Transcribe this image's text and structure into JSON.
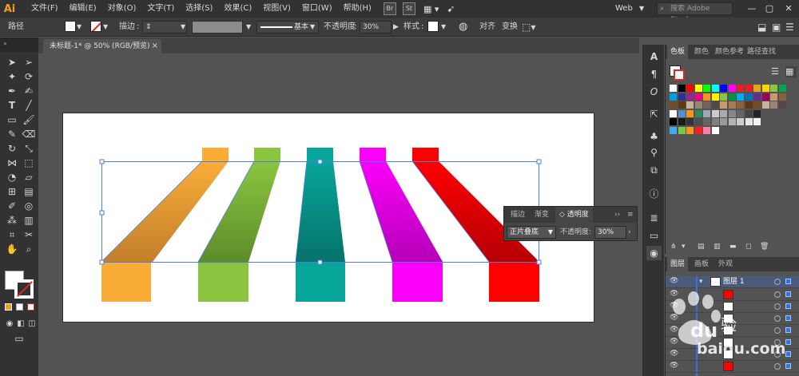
{
  "app": {
    "logo": "Ai"
  },
  "menu": [
    "文件(F)",
    "编辑(E)",
    "对象(O)",
    "文字(T)",
    "选择(S)",
    "效果(C)",
    "视图(V)",
    "窗口(W)",
    "帮助(H)"
  ],
  "menubar_right": {
    "br": "Br",
    "st": "St",
    "workspace": "Web",
    "search_placeholder": "搜索 Adobe Stock"
  },
  "controlbar": {
    "selection_type": "路径",
    "stroke_label": "描边",
    "stroke_style_label": "基本",
    "opacity_label": "不透明度",
    "opacity_value": "30%",
    "style_label": "样式",
    "align_label": "对齐",
    "transform_label": "变换"
  },
  "document": {
    "tab_title": "未标题-1* @ 50% (RGB/预览)"
  },
  "transparency_panel": {
    "tabs": [
      "描边",
      "渐变",
      "透明度"
    ],
    "blend_mode": "正片叠底",
    "opacity_label": "不透明度:",
    "opacity_value": "30%"
  },
  "swatches_panel": {
    "tabs": [
      "色板",
      "颜色",
      "颜色参考",
      "路径查找"
    ]
  },
  "layers_panel": {
    "tabs": [
      "图层",
      "画板",
      "外观"
    ],
    "layer_name": "图层 1"
  },
  "artwork": {
    "colors": [
      "#f9ad37",
      "#8bc53f",
      "#08a59b",
      "#fb00f9",
      "#fe0000"
    ],
    "shadow_opacity": 0.3
  },
  "watermark": {
    "text": "baidu.com",
    "brand": "Bai 经验"
  }
}
